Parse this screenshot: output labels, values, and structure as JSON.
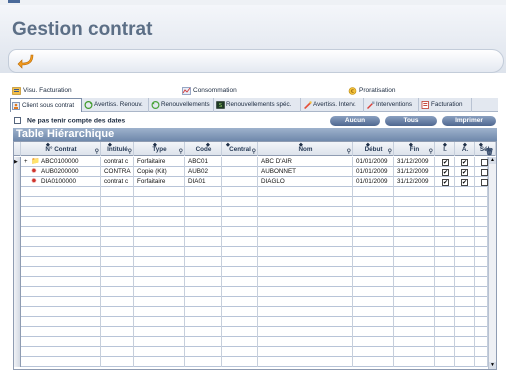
{
  "app": {
    "title": "Gestion contrat"
  },
  "tabs_row1": [
    {
      "label": "Visu. Facturation",
      "icon": "invoice-view-icon"
    },
    {
      "label": "Consommation",
      "icon": "consumption-chart-icon"
    },
    {
      "label": "Proratisation",
      "icon": "euro-coin-icon"
    }
  ],
  "tabs_row2": [
    {
      "label": "Client sous contrat",
      "icon": "client-contract-icon",
      "active": true
    },
    {
      "label": "Avertiss. Renouv.",
      "icon": "renewal-warning-icon"
    },
    {
      "label": "Renouvellements",
      "icon": "renewal-icon"
    },
    {
      "label": "Renouvellements spéc.",
      "icon": "special-renewal-icon"
    },
    {
      "label": "Avertiss. Interv.",
      "icon": "intervention-warning-icon"
    },
    {
      "label": "Interventions",
      "icon": "intervention-icon"
    },
    {
      "label": "Facturation",
      "icon": "billing-icon"
    }
  ],
  "options": {
    "ignore_dates_label": "Ne pas tenir compte des dates"
  },
  "buttons": {
    "none": "Aucun",
    "all": "Tous",
    "print": "Imprimer"
  },
  "table": {
    "title": "Table Hiérarchique",
    "columns": [
      "N° Contrat",
      "Intitulé",
      "Type",
      "Code",
      "Central",
      "Nom",
      "Début",
      "Fin",
      "I.",
      "A.",
      "Sél."
    ],
    "rows": [
      {
        "contrat": "ABC0100000",
        "intitule": "contrat c",
        "type": "Forfaitaire",
        "code": "ABC01",
        "central": "",
        "nom": "ABC D'AIR",
        "debut": "01/01/2009",
        "fin": "31/12/2009",
        "i": true,
        "a": true,
        "sel": false,
        "icon": "folder-icon",
        "current": true
      },
      {
        "contrat": "AUB0200000",
        "intitule": "CONTRA",
        "type": "Copie (Kit)",
        "code": "AUB02",
        "central": "",
        "nom": "AUBONNET",
        "debut": "01/01/2009",
        "fin": "31/12/2009",
        "i": true,
        "a": true,
        "sel": false,
        "icon": "gear-icon",
        "current": false
      },
      {
        "contrat": "DIA0100000",
        "intitule": "contrat c",
        "type": "Forfaitaire",
        "code": "DIA01",
        "central": "",
        "nom": "DIAGLO",
        "debut": "01/01/2009",
        "fin": "31/12/2009",
        "i": true,
        "a": true,
        "sel": false,
        "icon": "gear-icon",
        "current": false
      }
    ]
  },
  "colors": {
    "accent": "#6f88ab",
    "title": "#5c6f86"
  }
}
